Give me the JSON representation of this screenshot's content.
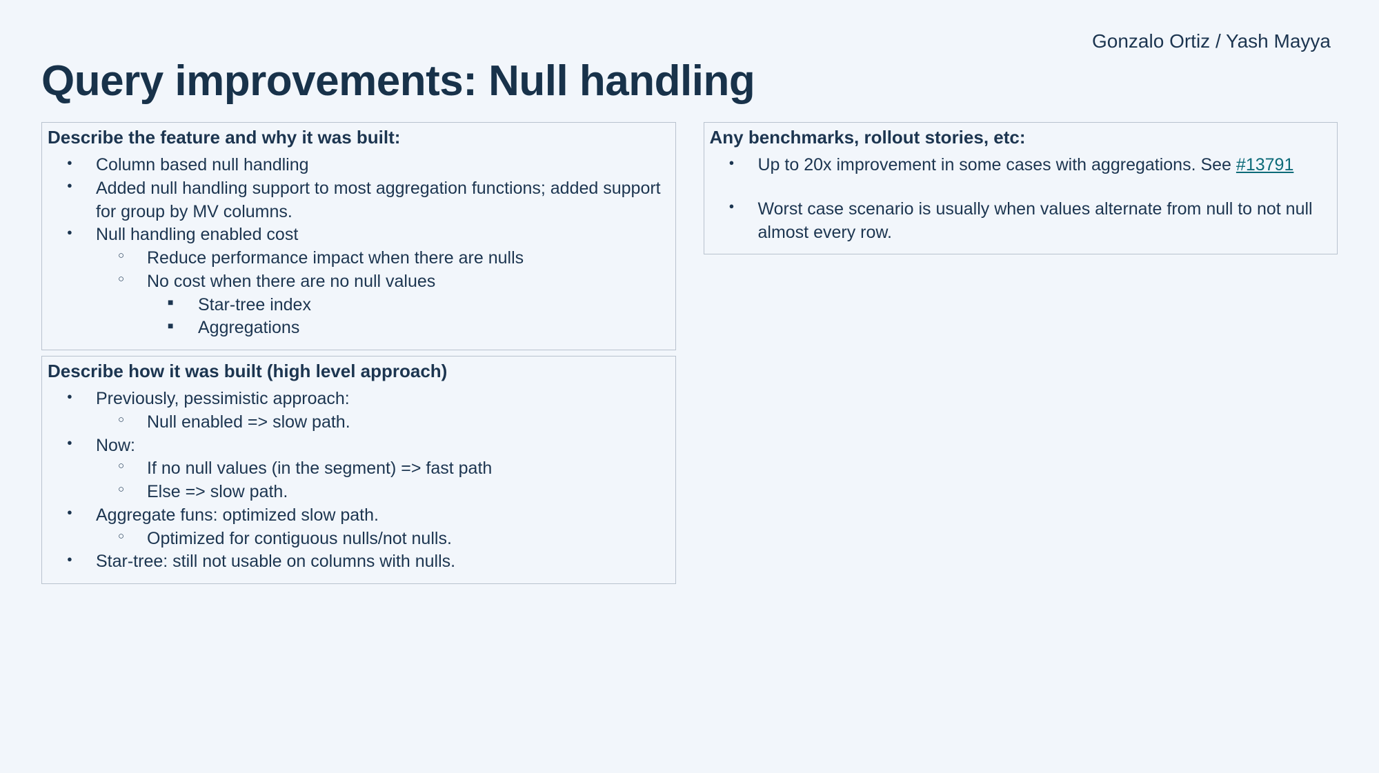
{
  "authors": "Gonzalo Ortiz / Yash Mayya",
  "title": "Query improvements: Null handling",
  "left": {
    "card1": {
      "heading": "Describe the feature and why it was built:",
      "b1": "Column based null handling",
      "b2": "Added null handling support to most aggregation functions; added support for group by MV columns.",
      "b3": "Null handling enabled cost",
      "b3s1": "Reduce performance impact when there are nulls",
      "b3s2": "No cost when there are no null values",
      "b3s2a": "Star-tree index",
      "b3s2b": "Aggregations"
    },
    "card2": {
      "heading": "Describe how it was built (high level approach)",
      "b1": "Previously, pessimistic approach:",
      "b1s1": "Null enabled => slow path.",
      "b2": "Now:",
      "b2s1": "If no null values (in the segment) => fast path",
      "b2s2": "Else => slow path.",
      "b3": "Aggregate funs: optimized slow path.",
      "b3s1": "Optimized for contiguous nulls/not nulls.",
      "b4": "Star-tree: still not usable on columns with nulls."
    }
  },
  "right": {
    "card1": {
      "heading": "Any benchmarks, rollout stories, etc:",
      "b1_pre": "Up to 20x improvement in some cases with aggregations. See ",
      "b1_link": "#13791",
      "b2": "Worst case scenario is usually when values alternate from null to not null almost every row."
    }
  }
}
